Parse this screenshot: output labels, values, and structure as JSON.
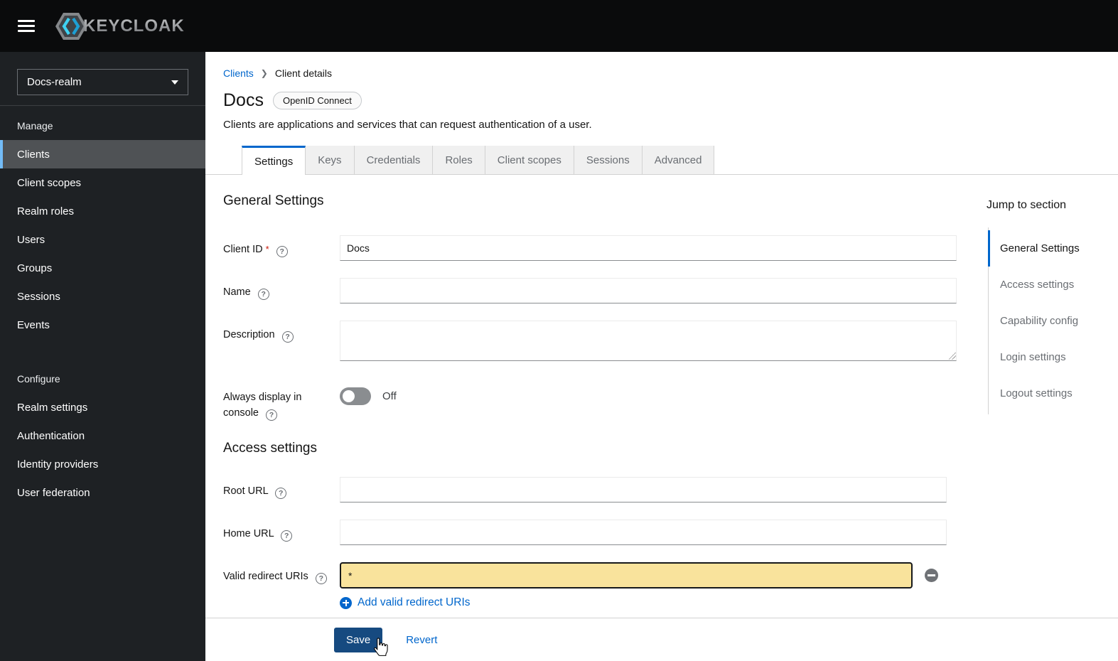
{
  "topbar": {
    "brand": "KEYCLOAK"
  },
  "sidebar": {
    "realm": "Docs-realm",
    "manage_header": "Manage",
    "manage_items": [
      "Clients",
      "Client scopes",
      "Realm roles",
      "Users",
      "Groups",
      "Sessions",
      "Events"
    ],
    "configure_header": "Configure",
    "configure_items": [
      "Realm settings",
      "Authentication",
      "Identity providers",
      "User federation"
    ],
    "active_item": "Clients"
  },
  "breadcrumb": {
    "parent": "Clients",
    "current": "Client details"
  },
  "page": {
    "title": "Docs",
    "badge": "OpenID Connect",
    "subtitle": "Clients are applications and services that can request authentication of a user."
  },
  "tabs": {
    "items": [
      "Settings",
      "Keys",
      "Credentials",
      "Roles",
      "Client scopes",
      "Sessions",
      "Advanced"
    ],
    "active": "Settings"
  },
  "form": {
    "general_heading": "General Settings",
    "client_id": {
      "label": "Client ID",
      "value": "Docs",
      "required": "*"
    },
    "name": {
      "label": "Name",
      "value": ""
    },
    "description": {
      "label": "Description",
      "value": ""
    },
    "always_display": {
      "label": "Always display in console",
      "state": "Off"
    },
    "access_heading": "Access settings",
    "root_url": {
      "label": "Root URL",
      "value": ""
    },
    "home_url": {
      "label": "Home URL",
      "value": ""
    },
    "valid_redirect": {
      "label": "Valid redirect URIs",
      "value": "*",
      "add_link": "Add valid redirect URIs"
    }
  },
  "jump_nav": {
    "title": "Jump to section",
    "items": [
      "General Settings",
      "Access settings",
      "Capability config",
      "Login settings",
      "Logout settings"
    ],
    "active": "General Settings"
  },
  "footer": {
    "save": "Save",
    "revert": "Revert"
  },
  "colors": {
    "accent": "#0066cc",
    "topbar_bg": "#0a0b0c",
    "sidebar_bg": "#1e2124",
    "sidebar_active_bg": "#4f5255",
    "sidebar_active_border": "#73bcf7",
    "save_button": "#164a80",
    "highlight_input_bg": "#f9e39c",
    "required_asterisk": "#c9190b",
    "inactive_tab_bg": "#f0f0f0"
  }
}
